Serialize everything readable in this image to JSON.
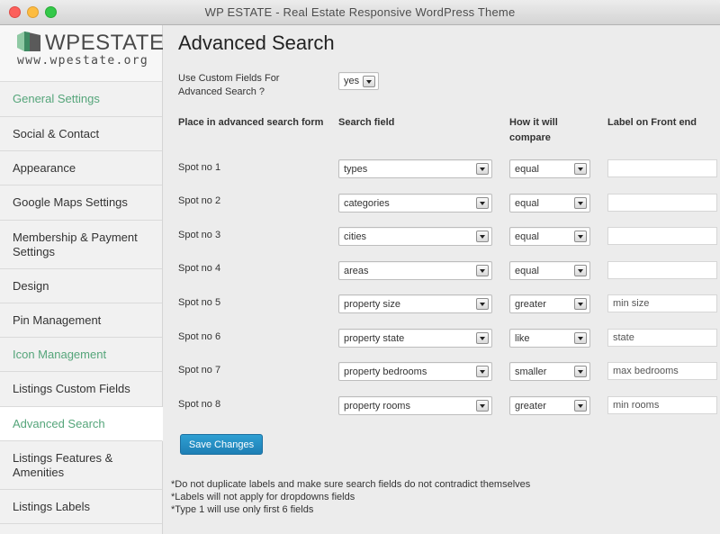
{
  "window": {
    "title": "WP ESTATE - Real Estate Responsive WordPress Theme"
  },
  "logo": {
    "name": "WPESTATE",
    "url": "www.wpestate.org"
  },
  "sidebar": {
    "items": [
      {
        "label": "General Settings"
      },
      {
        "label": "Social & Contact"
      },
      {
        "label": "Appearance"
      },
      {
        "label": "Google Maps Settings"
      },
      {
        "label": "Membership & Payment Settings"
      },
      {
        "label": "Design"
      },
      {
        "label": "Pin Management"
      },
      {
        "label": "Icon Management"
      },
      {
        "label": "Listings Custom Fields"
      },
      {
        "label": "Advanced Search"
      },
      {
        "label": "Listings Features & Amenities"
      },
      {
        "label": "Listings Labels"
      }
    ]
  },
  "main": {
    "title": "Advanced Search",
    "custom_fields_label": "Use Custom Fields For Advanced Search ?",
    "custom_fields_value": "yes",
    "columns": {
      "place": "Place in advanced search form",
      "field": "Search field",
      "compare": "How it will compare",
      "label": "Label on Front end"
    },
    "rows": [
      {
        "spot": "Spot no 1",
        "field": "types",
        "compare": "equal",
        "label": ""
      },
      {
        "spot": "Spot no 2",
        "field": "categories",
        "compare": "equal",
        "label": ""
      },
      {
        "spot": "Spot no 3",
        "field": "cities",
        "compare": "equal",
        "label": ""
      },
      {
        "spot": "Spot no 4",
        "field": "areas",
        "compare": "equal",
        "label": ""
      },
      {
        "spot": "Spot no 5",
        "field": "property size",
        "compare": "greater",
        "label": "min size"
      },
      {
        "spot": "Spot no 6",
        "field": "property state",
        "compare": "like",
        "label": "state"
      },
      {
        "spot": "Spot no 7",
        "field": "property bedrooms",
        "compare": "smaller",
        "label": "max bedrooms"
      },
      {
        "spot": "Spot no 8",
        "field": "property rooms",
        "compare": "greater",
        "label": "min rooms"
      }
    ],
    "save_label": "Save Changes",
    "notes": [
      "*Do not duplicate labels and make sure search fields do not contradict themselves",
      "*Labels will not apply for dropdowns fields",
      "*Type 1 will use only first 6 fields"
    ]
  },
  "colors": {
    "accent_green": "#55a57a",
    "button_blue": "#2589c0"
  }
}
